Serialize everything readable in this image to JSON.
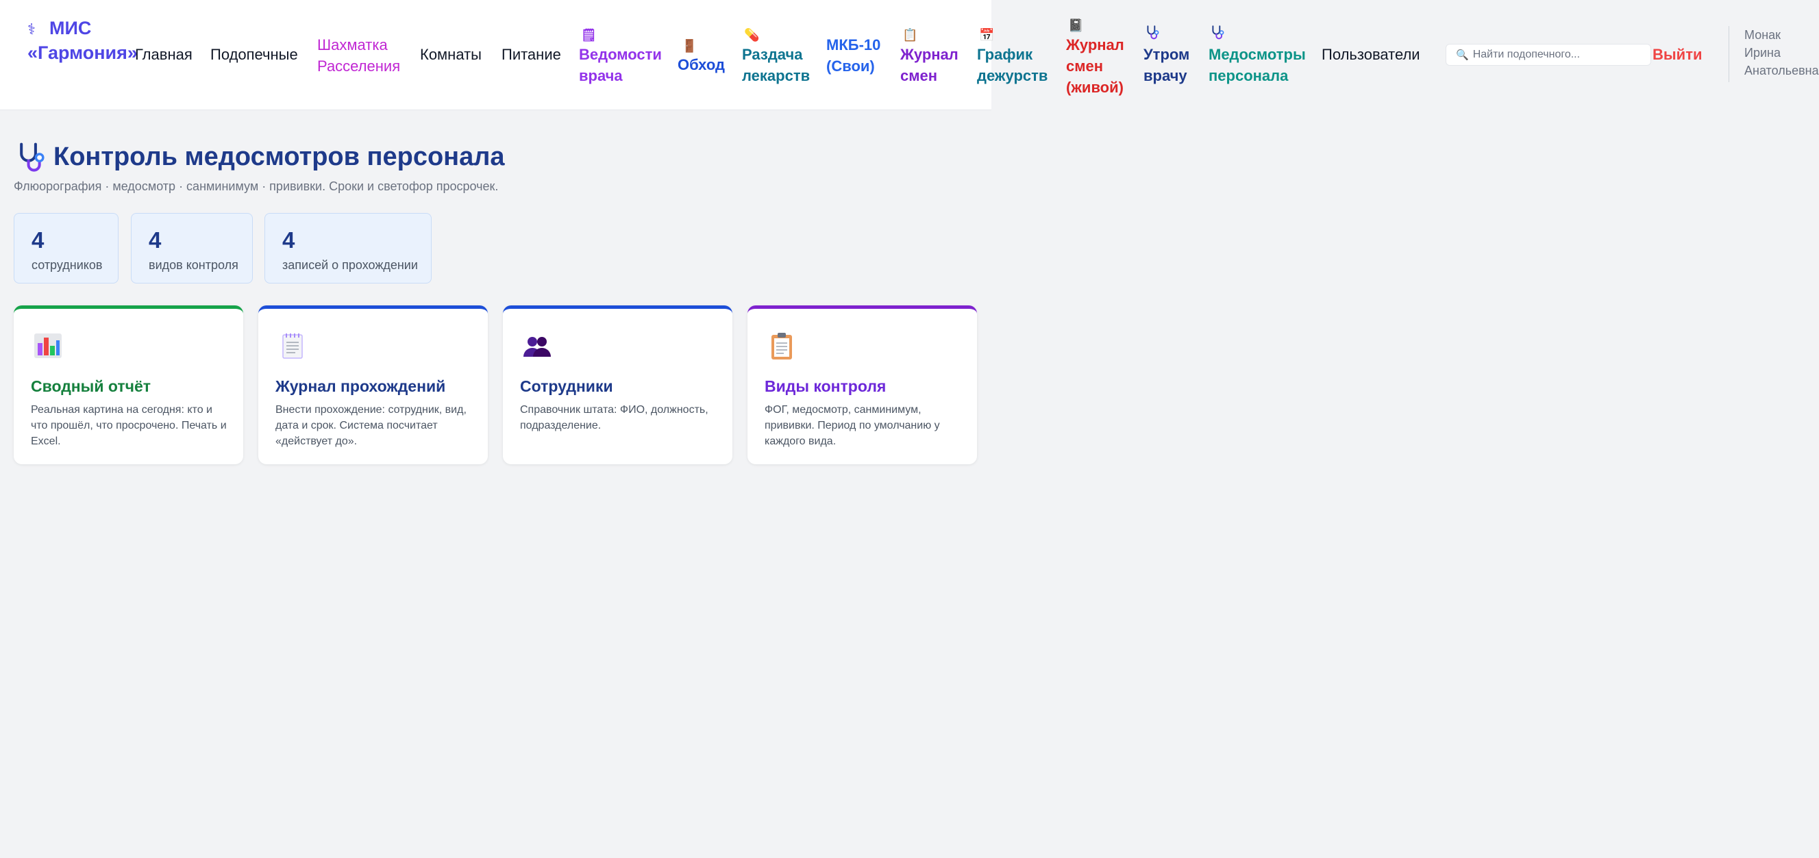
{
  "header": {
    "brand_line1": "МИС",
    "brand_line2": "«Гармония»",
    "nav": [
      {
        "label": "Главная",
        "color": "#111827"
      },
      {
        "label": "Подопечные",
        "color": "#111827"
      },
      {
        "label": "Шахматка Расселения",
        "color": "#c026d3"
      },
      {
        "label": "Комнаты",
        "color": "#111827"
      },
      {
        "label": "Питание",
        "color": "#111827"
      },
      {
        "label": "Ведомости врача",
        "color": "#9333ea",
        "icon": "notepad-icon"
      },
      {
        "label": "Обход",
        "color": "#1d4ed8",
        "icon": "door-icon"
      },
      {
        "label": "Раздача лекарств",
        "color": "#0e7490",
        "icon": "pill-icon"
      },
      {
        "label": "МКБ-10 (Свои)",
        "color": "#2563eb"
      },
      {
        "label": "Журнал смен",
        "color": "#7e22ce",
        "icon": "clipboard-icon"
      },
      {
        "label": "График дежурств",
        "color": "#0e7490",
        "icon": "calendar-icon"
      },
      {
        "label": "Журнал смен (живой)",
        "color": "#dc2626",
        "icon": "notebook-icon"
      },
      {
        "label": "Утром врачу",
        "color": "#1e3a8a",
        "icon": "stethoscope-icon"
      },
      {
        "label": "Медосмотры персонала",
        "color": "#0d9488",
        "icon": "stethoscope-icon"
      },
      {
        "label": "Пользователи",
        "color": "#111827"
      }
    ],
    "search_placeholder": "Найти подопечного...",
    "logout_label": "Выйти",
    "user_name_line1": "Монак",
    "user_name_line2": "Ирина",
    "user_name_line3": "Анатольевна"
  },
  "page": {
    "title": "Контроль медосмотров персонала",
    "subtitle": "Флюорография · медосмотр · санминимум · прививки. Сроки и светофор просрочек."
  },
  "stats": [
    {
      "value": "4",
      "label": "сотрудников"
    },
    {
      "value": "4",
      "label": "видов контроля"
    },
    {
      "value": "4",
      "label": "записей о прохождении"
    }
  ],
  "cards": [
    {
      "icon": "bar-chart-icon",
      "title": "Сводный отчёт",
      "description": "Реальная картина на сегодня: кто и что прошёл, что просрочено. Печать и Excel.",
      "color": "#15803d",
      "accent": "#16a34a"
    },
    {
      "icon": "notepad-icon",
      "title": "Журнал прохождений",
      "description": "Внести прохождение: сотрудник, вид, дата и срок. Система посчитает «действует до».",
      "color": "#1e3a8a",
      "accent": "#1d4ed8"
    },
    {
      "icon": "people-icon",
      "title": "Сотрудники",
      "description": "Справочник штата: ФИО, должность, подразделение.",
      "color": "#1e3a8a",
      "accent": "#1d4ed8"
    },
    {
      "icon": "clipboard-icon",
      "title": "Виды контроля",
      "description": "ФОГ, медосмотр, санминимум, прививки. Период по умолчанию у каждого вида.",
      "color": "#6d28d9",
      "accent": "#7e22ce"
    }
  ]
}
